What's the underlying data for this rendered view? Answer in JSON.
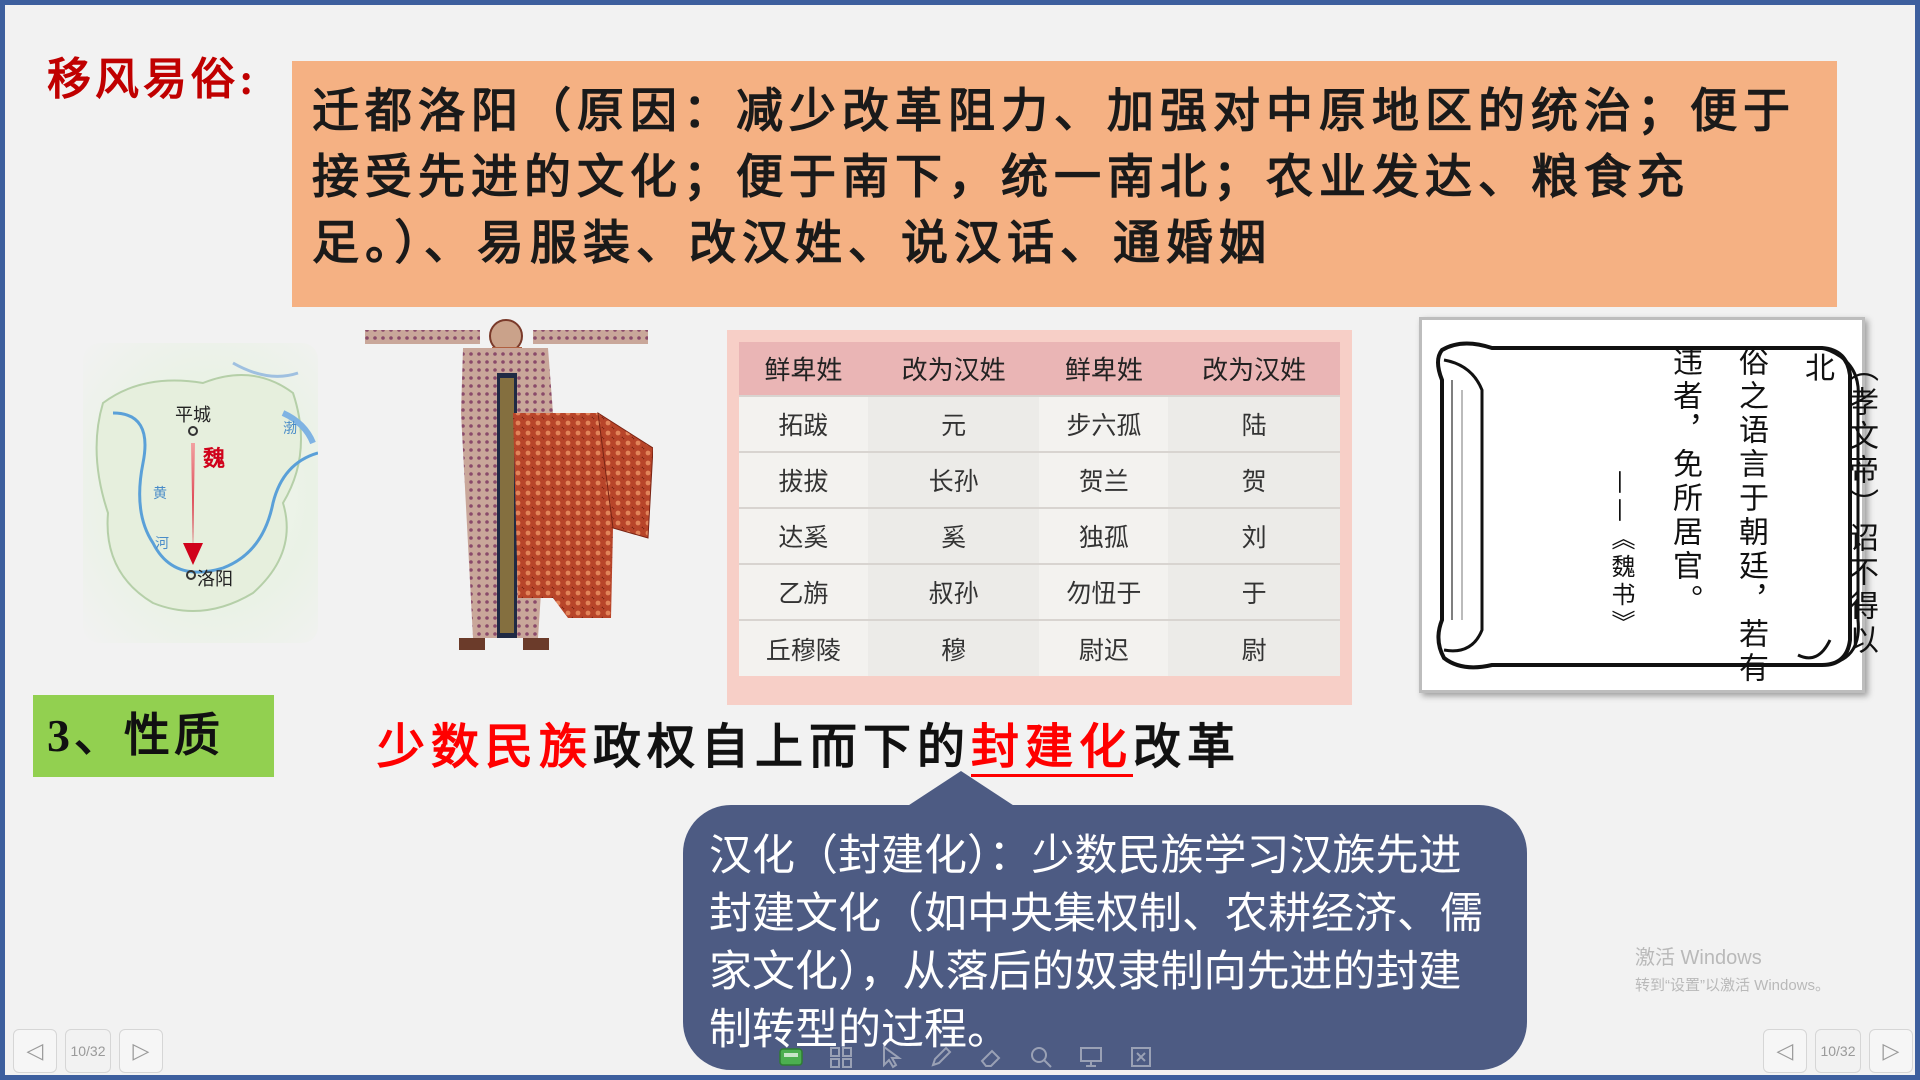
{
  "section_heading": "移风易俗:",
  "top_box_text": "迁都洛阳（原因：减少改革阻力、加强对中原地区的统治；便于接受先进的文化；便于南下，统一南北；农业发达、粮食充足。）、易服装、改汉姓、说汉话、通婚姻",
  "map": {
    "labels": {
      "north_city": "平城",
      "state": "魏",
      "south_city": "洛阳",
      "river_1": "黄",
      "river_2": "河",
      "sea": "渤"
    }
  },
  "surname_table": {
    "headers": [
      "鲜卑姓",
      "改为汉姓",
      "鲜卑姓",
      "改为汉姓"
    ],
    "rows": [
      [
        "拓跋",
        "元",
        "步六孤",
        "陆"
      ],
      [
        "拔拔",
        "长孙",
        "贺兰",
        "贺"
      ],
      [
        "达奚",
        "奚",
        "独孤",
        "刘"
      ],
      [
        "乙旃",
        "叔孙",
        "勿忸于",
        "于"
      ],
      [
        "丘穆陵",
        "穆",
        "尉迟",
        "尉"
      ]
    ]
  },
  "scroll": {
    "col1": "（孝文帝）诏不得以北",
    "col2": "俗之语言于朝廷，若有",
    "col3": "违者，免所居官。",
    "source": "——《魏书》"
  },
  "nature": {
    "label": "3、性质",
    "part_red_1": "少数民族",
    "part_black_1": "政权自上而下的",
    "part_red_2": "封建化",
    "part_black_2": "改革"
  },
  "callout_text": "汉化（封建化）：少数民族学习汉族先进封建文化（如中央集权制、农耕经济、儒家文化），从落后的奴隶制向先进的封建制转型的过程。",
  "activate_windows": {
    "title": "激活 Windows",
    "subtitle": "转到“设置”以激活 Windows。"
  },
  "nav": {
    "left_counter": "10/32",
    "right_counter": "10/32",
    "prev_glyph": "◁",
    "next_glyph": "▷"
  },
  "toolbar_icons": [
    "slide-icon",
    "grid-icon",
    "pointer-icon",
    "pen-icon",
    "eraser-icon",
    "zoom-icon",
    "screen-icon",
    "exit-icon"
  ],
  "colors": {
    "slide_border": "#3d5f9e",
    "top_box": "#f5b183",
    "heading_red": "#c00000",
    "nature_label": "#92d050",
    "callout": "#4d5b83",
    "table_header": "#eab5b5"
  }
}
